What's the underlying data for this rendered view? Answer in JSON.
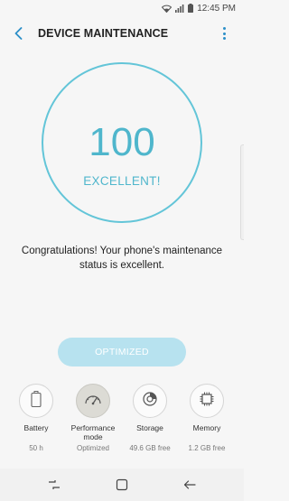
{
  "status_bar": {
    "time": "12:45 PM",
    "icons": [
      "wifi-icon",
      "signal-icon",
      "battery-icon"
    ]
  },
  "app_bar": {
    "title": "DEVICE MAINTENANCE",
    "back_icon": "back-arrow-icon",
    "more_icon": "more-options-icon"
  },
  "score": {
    "value": "100",
    "label": "EXCELLENT!"
  },
  "message": "Congratulations! Your phone's maintenance status is excellent.",
  "optimize_button": {
    "label": "OPTIMIZED"
  },
  "tiles": [
    {
      "name": "Battery",
      "value": "50 h",
      "icon": "battery-icon"
    },
    {
      "name": "Performance mode",
      "value": "Optimized",
      "icon": "speedometer-icon",
      "selected": true
    },
    {
      "name": "Storage",
      "value": "49.6 GB free",
      "icon": "storage-disc-icon"
    },
    {
      "name": "Memory",
      "value": "1.2 GB free",
      "icon": "memory-chip-icon"
    }
  ],
  "nav_bar": {
    "icons": [
      "recent-apps-icon",
      "home-icon",
      "back-icon"
    ]
  },
  "colors": {
    "accent": "#4fb6cc",
    "ring": "#63c5d8",
    "button_disabled": "#b7e2ef",
    "icon_blue": "#2c8fc8"
  }
}
